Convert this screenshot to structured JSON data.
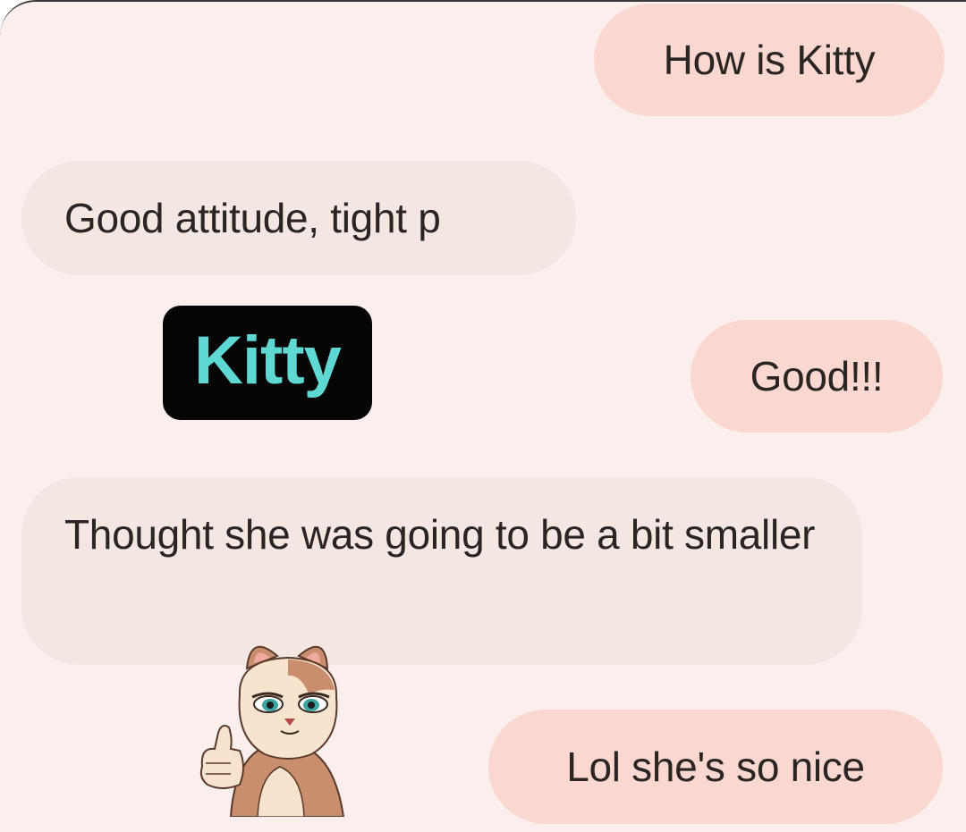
{
  "messages": [
    {
      "direction": "outgoing",
      "text": "How is Kitty"
    },
    {
      "direction": "incoming",
      "text": "Good attitude, tight p"
    },
    {
      "direction": "outgoing",
      "text": "Good!!!"
    },
    {
      "direction": "incoming",
      "text": "Thought she was going to be a bit smaller"
    },
    {
      "direction": "outgoing",
      "text": "Lol she's so nice"
    }
  ],
  "overlay_label": "Kitty",
  "sticker": {
    "icon": "cat-thumbs-up-sticker-icon"
  },
  "colors": {
    "background": "#faefec",
    "outgoing_bubble": "#fbd8cf",
    "incoming_bubble": "#f4e7e3",
    "text": "#2a2522",
    "label_bg": "#050505",
    "label_text": "#5fd8d4"
  }
}
